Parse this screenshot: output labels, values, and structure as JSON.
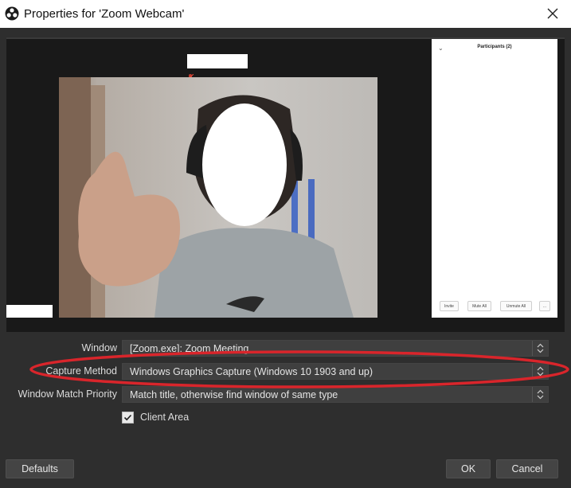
{
  "window": {
    "title": "Properties for 'Zoom Webcam'"
  },
  "preview": {
    "participants_title": "Participants (2)",
    "participant_buttons": [
      "Invite",
      "Mute All",
      "Unmute All",
      "..."
    ]
  },
  "properties": {
    "window_label": "Window",
    "window_value": "[Zoom.exe]: Zoom Meeting",
    "capture_method_label": "Capture Method",
    "capture_method_value": "Windows Graphics Capture (Windows 10 1903 and up)",
    "match_priority_label": "Window Match Priority",
    "match_priority_value": "Match title, otherwise find window of same type",
    "client_area_label": "Client Area",
    "client_area_checked": true
  },
  "footer": {
    "defaults_label": "Defaults",
    "ok_label": "OK",
    "cancel_label": "Cancel"
  },
  "colors": {
    "background": "#2e2e2e",
    "annotation": "#d9252b"
  }
}
